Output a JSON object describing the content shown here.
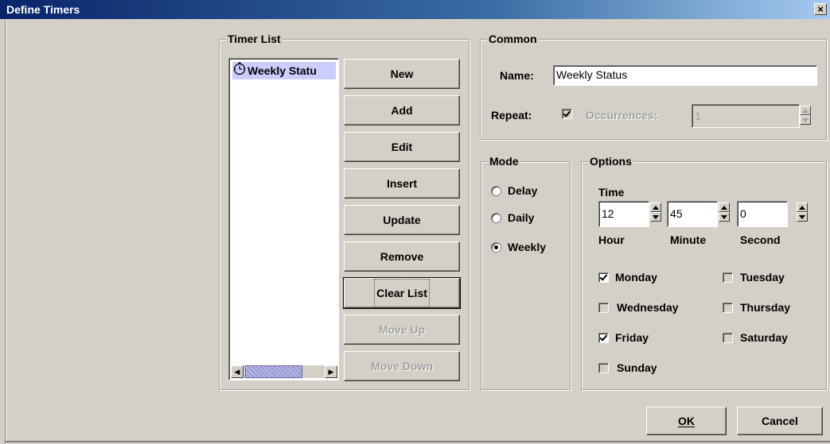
{
  "window": {
    "title": "Define Timers",
    "close_glyph": "×"
  },
  "timer_list": {
    "legend": "Timer List",
    "items": [
      {
        "label": "Weekly Statu",
        "icon": "timer-icon",
        "selected": true
      }
    ],
    "buttons": {
      "new": "New",
      "add": "Add",
      "edit": "Edit",
      "insert": "Insert",
      "update": "Update",
      "remove": "Remove",
      "clear_list": "Clear List",
      "move_up": "Move Up",
      "move_down": "Move Down"
    },
    "scroll_left_glyph": "◀",
    "scroll_right_glyph": "▶"
  },
  "common": {
    "legend": "Common",
    "name_label": "Name:",
    "name_value": "Weekly Status",
    "repeat_label": "Repeat:",
    "repeat_checked": true,
    "occurrences_label": "Occurrences:",
    "occurrences_value": "1"
  },
  "mode": {
    "legend": "Mode",
    "options": [
      "Delay",
      "Daily",
      "Weekly"
    ],
    "selected": "Weekly"
  },
  "options": {
    "legend": "Options",
    "time_label": "Time",
    "hour_value": "12",
    "minute_value": "45",
    "second_value": "0",
    "hour_label": "Hour",
    "minute_label": "Minute",
    "second_label": "Second",
    "days": {
      "monday": "Monday",
      "tuesday": "Tuesday",
      "wednesday": "Wednesday",
      "thursday": "Thursday",
      "friday": "Friday",
      "saturday": "Saturday",
      "sunday": "Sunday"
    },
    "checked_days": [
      "Monday",
      "Friday"
    ]
  },
  "footer": {
    "ok": "OK",
    "cancel": "Cancel"
  },
  "colors": {
    "title_bar": "#0a246a",
    "dialog_bg": "#d4d0c8",
    "selection": "#ccccff"
  }
}
